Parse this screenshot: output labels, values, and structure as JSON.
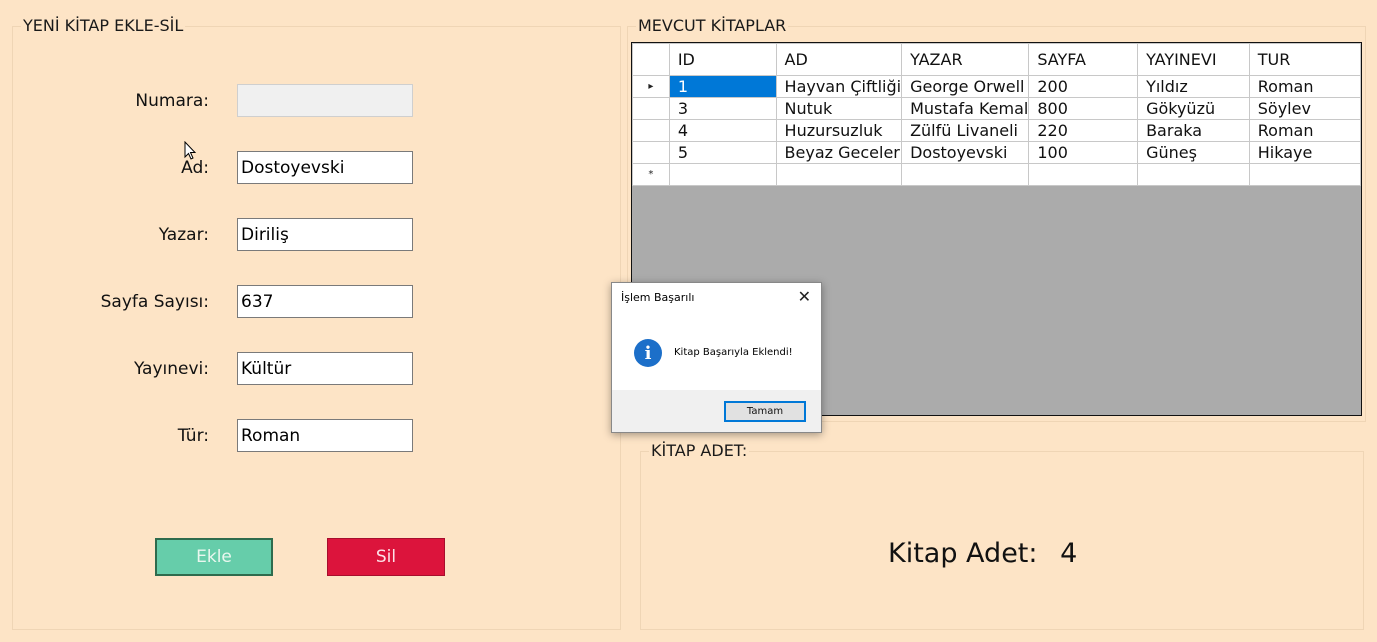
{
  "left_group": {
    "title": "YENİ KİTAP EKLE-SİL",
    "fields": [
      {
        "label": "Numara:",
        "value": ""
      },
      {
        "label": "Ad:",
        "value": "Dostoyevski"
      },
      {
        "label": "Yazar:",
        "value": "Diriliş"
      },
      {
        "label": "Sayfa Sayısı:",
        "value": "637"
      },
      {
        "label": "Yayınevi:",
        "value": "Kültür"
      },
      {
        "label": "Tür:",
        "value": "Roman"
      }
    ],
    "add_button": "Ekle",
    "delete_button": "Sil"
  },
  "books_group": {
    "title": "MEVCUT KİTAPLAR",
    "columns": [
      "ID",
      "AD",
      "YAZAR",
      "SAYFA",
      "YAYINEVI",
      "TUR"
    ],
    "rows": [
      [
        "1",
        "Hayvan Çiftliği",
        "George Orwell",
        "200",
        "Yıldız",
        "Roman"
      ],
      [
        "3",
        "Nutuk",
        "Mustafa Kemal",
        "800",
        "Gökyüzü",
        "Söylev"
      ],
      [
        "4",
        "Huzursuzluk",
        "Zülfü Livaneli",
        "220",
        "Baraka",
        "Roman"
      ],
      [
        "5",
        "Beyaz Geceler",
        "Dostoyevski",
        "100",
        "Güneş",
        "Hikaye"
      ]
    ],
    "current_row_marker": "▸",
    "new_row_marker": "*"
  },
  "count_group": {
    "title": "KİTAP ADET:",
    "label": "Kitap Adet:",
    "value": "4"
  },
  "dialog": {
    "title": "İşlem Başarılı",
    "close": "✕",
    "icon": "info-icon",
    "icon_glyph": "i",
    "message": "Kitap Başarıyla Eklendi!",
    "ok_button": "Tamam"
  }
}
